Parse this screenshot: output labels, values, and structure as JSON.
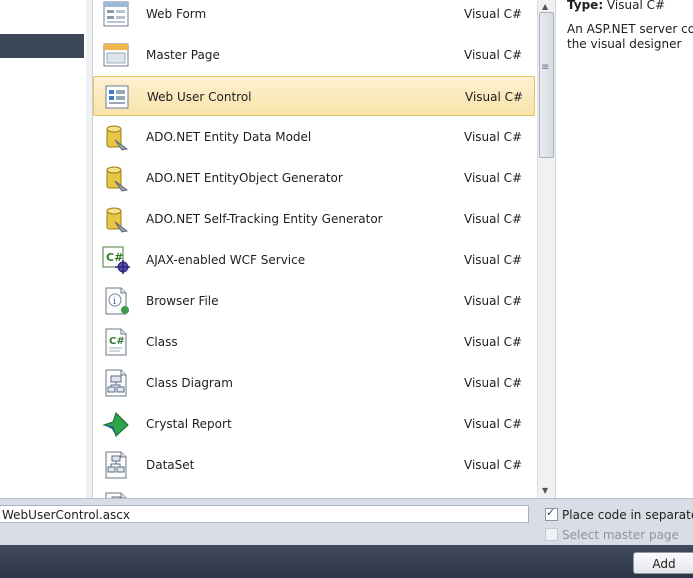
{
  "templates": [
    {
      "name": "Web Form",
      "lang": "Visual C#",
      "icon": "web-form-icon"
    },
    {
      "name": "Master Page",
      "lang": "Visual C#",
      "icon": "master-page-icon"
    },
    {
      "name": "Web User Control",
      "lang": "Visual C#",
      "icon": "web-user-control-icon",
      "selected": true
    },
    {
      "name": "ADO.NET Entity Data Model",
      "lang": "Visual C#",
      "icon": "entity-data-model-icon"
    },
    {
      "name": "ADO.NET EntityObject Generator",
      "lang": "Visual C#",
      "icon": "entity-generator-icon"
    },
    {
      "name": "ADO.NET Self-Tracking Entity Generator",
      "lang": "Visual C#",
      "icon": "self-tracking-generator-icon"
    },
    {
      "name": "AJAX-enabled WCF Service",
      "lang": "Visual C#",
      "icon": "wcf-service-icon"
    },
    {
      "name": "Browser File",
      "lang": "Visual C#",
      "icon": "browser-file-icon"
    },
    {
      "name": "Class",
      "lang": "Visual C#",
      "icon": "class-icon"
    },
    {
      "name": "Class Diagram",
      "lang": "Visual C#",
      "icon": "class-diagram-icon"
    },
    {
      "name": "Crystal Report",
      "lang": "Visual C#",
      "icon": "crystal-report-icon"
    },
    {
      "name": "DataSet",
      "lang": "Visual C#",
      "icon": "dataset-icon"
    }
  ],
  "details": {
    "type_label": "Type:",
    "type_value": "Visual C#",
    "description_line1": "An ASP.NET server contr",
    "description_line2": "the visual designer"
  },
  "name_field": {
    "value": "WebUserControl.ascx"
  },
  "options": {
    "separate_file_label": "Place code in separate fil",
    "separate_file_checked": true,
    "master_page_label": "Select master page",
    "master_page_checked": false
  },
  "buttons": {
    "add_label": "Add"
  },
  "colors": {
    "selection_bg": "#f8e3a8",
    "footer_bg": "#2d3646"
  }
}
